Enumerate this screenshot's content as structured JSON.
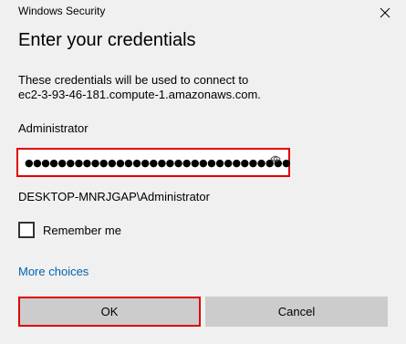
{
  "window": {
    "title": "Windows Security",
    "heading": "Enter your credentials"
  },
  "message": {
    "line1": "These credentials will be used to connect to",
    "line2": "ec2-3-93-46-181.compute-1.amazonaws.com."
  },
  "username": "Administrator",
  "password": {
    "masked_value": "●●●●●●●●●●●●●●●●●●●●●●●●●●●●●●●●"
  },
  "account": "DESKTOP-MNRJGAP\\Administrator",
  "remember": {
    "label": "Remember me",
    "checked": false
  },
  "links": {
    "more_choices": "More choices"
  },
  "buttons": {
    "ok": "OK",
    "cancel": "Cancel"
  },
  "colors": {
    "highlight": "#e00000",
    "link": "#0063b1",
    "button": "#cccccc",
    "background": "#f0f0f0"
  },
  "icons": {
    "close": "close-icon",
    "reveal": "eye-icon"
  }
}
